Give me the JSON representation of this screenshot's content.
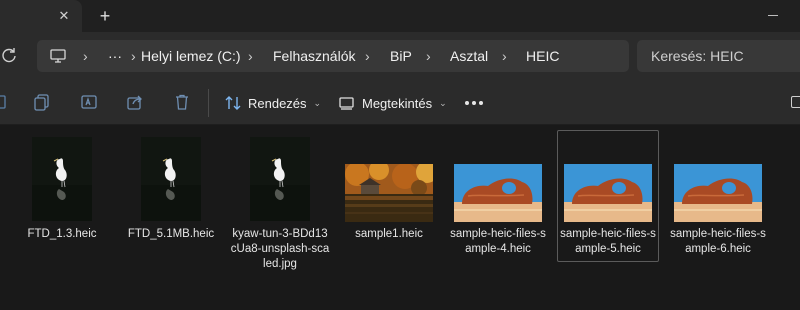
{
  "tab": {
    "close_glyph": "✕",
    "new_tab_glyph": "+"
  },
  "address": {
    "overflow": "···",
    "separator": "›",
    "crumbs": [
      "Helyi lemez (C:)",
      "Felhasználók",
      "BiP",
      "Asztal",
      "HEIC"
    ]
  },
  "search": {
    "placeholder": "Keresés: HEIC"
  },
  "toolbar": {
    "sort_label": "Rendezés",
    "view_label": "Megtekintés",
    "chevron": "⌄"
  },
  "files": [
    {
      "name": "FTD_1.3.heic",
      "thumb": "egret",
      "selected": false
    },
    {
      "name": "FTD_5.1MB.heic",
      "thumb": "egret",
      "selected": false
    },
    {
      "name": "kyaw-tun-3-BDd13cUa8-unsplash-scaled.jpg",
      "thumb": "egret",
      "selected": false
    },
    {
      "name": "sample1.heic",
      "thumb": "autumn-lake",
      "selected": false
    },
    {
      "name": "sample-heic-files-sample-4.heic",
      "thumb": "rock-arch",
      "selected": false
    },
    {
      "name": "sample-heic-files-sample-5.heic",
      "thumb": "rock-arch",
      "selected": true
    },
    {
      "name": "sample-heic-files-sample-6.heic",
      "thumb": "rock-arch",
      "selected": false
    }
  ],
  "colors": {
    "background": "#191919",
    "chrome": "#2b2b2b",
    "field": "#383838",
    "accent_icon": "#7eb6f0"
  }
}
